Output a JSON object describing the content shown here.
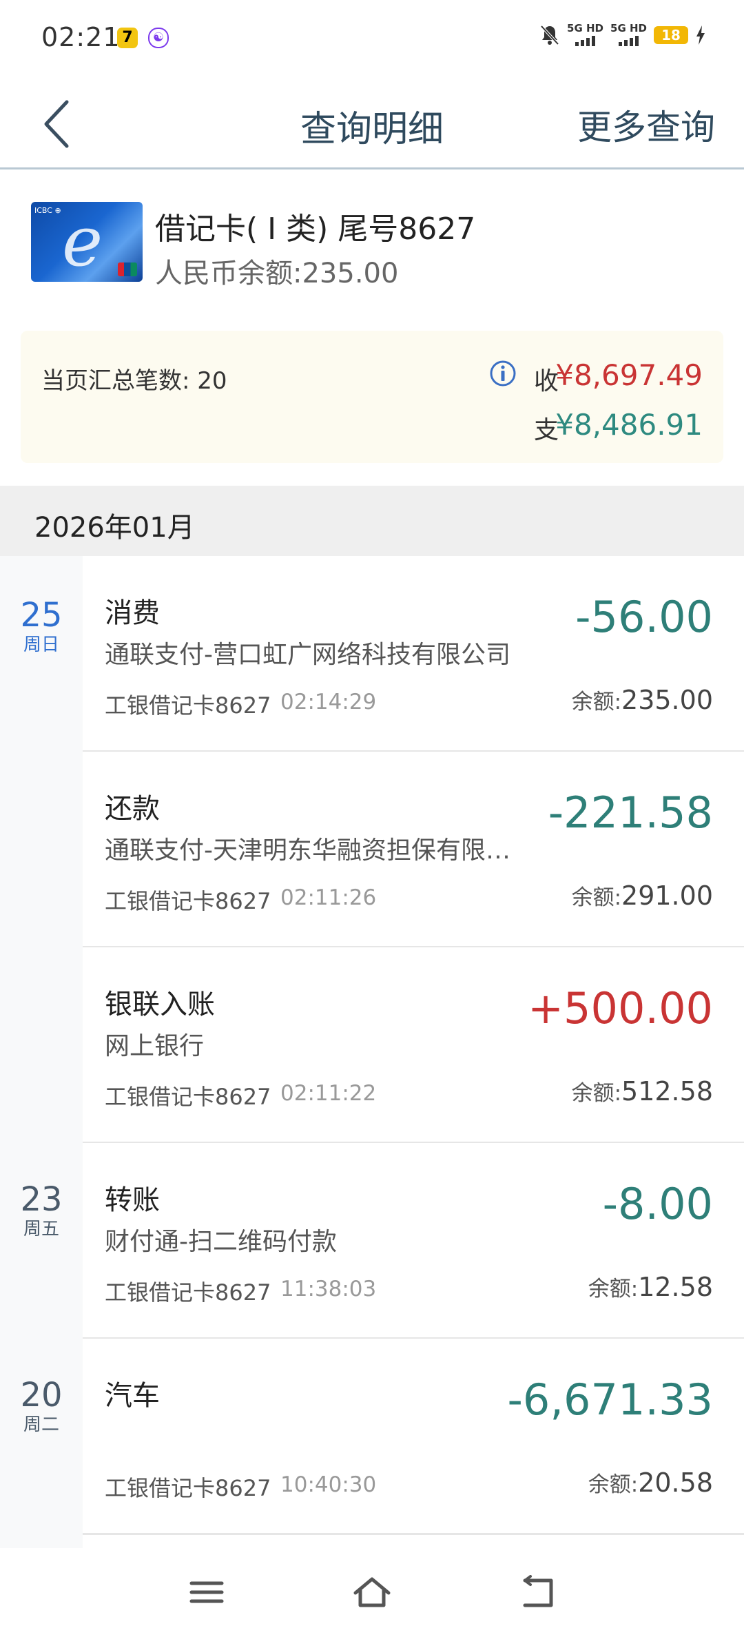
{
  "status_bar": {
    "time": "02:21",
    "badges": [
      {
        "icon": "qq-app-icon",
        "text": "7",
        "bg": "#f2c511",
        "fg": "#000000"
      },
      {
        "icon": "notify-app-icon",
        "text": "☯",
        "bg": "#ffffff",
        "fg": "#7c3aed"
      }
    ],
    "signal1": "5G HD",
    "signal2": "5G HD",
    "battery": "18",
    "icons": [
      "bell-muted-icon",
      "signal-icon",
      "signal-icon",
      "battery-icon",
      "charging-icon"
    ]
  },
  "header": {
    "back_icon": "back-arrow-icon",
    "title": "查询明细",
    "more": "更多查询"
  },
  "card": {
    "name": "借记卡( Ⅰ 类) 尾号8627",
    "balance": "人民币余额:235.00"
  },
  "summary": {
    "count": "当页汇总笔数: 20",
    "income_label": "收",
    "income_value": "¥8,697.49",
    "expense_label": "支",
    "expense_value": "¥8,486.91"
  },
  "month": "2026年01月",
  "dates": [
    {
      "day": "25",
      "weekday": "周日",
      "color": "#2f6fcf"
    },
    {
      "day": "23",
      "weekday": "周五",
      "color": "#4a5a6a"
    },
    {
      "day": "20",
      "weekday": "周二",
      "color": "#4a5a6a"
    }
  ],
  "transactions": [
    {
      "type": "消费",
      "desc": "通联支付-营口虹广网络科技有限公司",
      "card": "工银借记卡8627",
      "time": "02:14:29",
      "amount": "-56.00",
      "balance_label": "余额:",
      "balance": "235.00",
      "sign": "neg"
    },
    {
      "type": "还款",
      "desc": "通联支付-天津明东华融资担保有限…",
      "card": "工银借记卡8627",
      "time": "02:11:26",
      "amount": "-221.58",
      "balance_label": "余额:",
      "balance": "291.00",
      "sign": "neg"
    },
    {
      "type": "银联入账",
      "desc": "网上银行",
      "card": "工银借记卡8627",
      "time": "02:11:22",
      "amount": "+500.00",
      "balance_label": "余额:",
      "balance": "512.58",
      "sign": "pos"
    },
    {
      "type": "转账",
      "desc": "财付通-扫二维码付款",
      "card": "工银借记卡8627",
      "time": "11:38:03",
      "amount": "-8.00",
      "balance_label": "余额:",
      "balance": "12.58",
      "sign": "neg"
    },
    {
      "type": "汽车",
      "desc": "",
      "card": "工银借记卡8627",
      "time": "10:40:30",
      "amount": "-6,671.33",
      "balance_label": "余额:",
      "balance": "20.58",
      "sign": "neg"
    }
  ],
  "nav": [
    "menu-icon",
    "home-icon",
    "back-icon"
  ]
}
